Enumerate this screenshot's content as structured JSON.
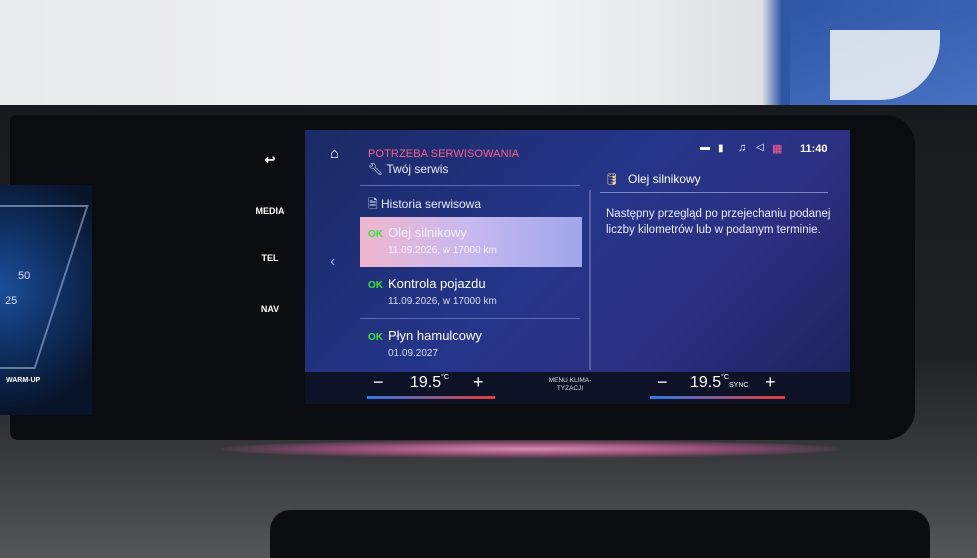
{
  "header": {
    "title": "POTRZEBA SERWISOWANIA",
    "submenu": "Twój serwis",
    "history": "Historia serwisowa"
  },
  "left_buttons": [
    {
      "label": "MEDIA"
    },
    {
      "label": "TEL"
    },
    {
      "label": "NAV"
    }
  ],
  "cluster": {
    "n50": "50",
    "n25": "25",
    "warmup": "WARM-UP"
  },
  "items": [
    {
      "status": "OK",
      "title": "Olej silnikowy",
      "sub": "11.09.2026, w 17000 km"
    },
    {
      "status": "OK",
      "title": "Kontrola pojazdu",
      "sub": "11.09.2026, w 17000 km"
    },
    {
      "status": "OK",
      "title": "Płyn hamulcowy",
      "sub": "01.09.2027"
    }
  ],
  "detail": {
    "title": "Olej silnikowy",
    "text": "Następny przegląd po przejechaniu podanej liczby kilometrów lub w podanym terminie."
  },
  "status_bar": {
    "time": "11:40"
  },
  "climate": {
    "left_temp": "19.5",
    "left_unit": "°C",
    "right_temp": "19.5",
    "right_unit": "°C",
    "right_sync": "SYNC",
    "menu_line1": "MENU KLIMA-",
    "menu_line2": "TYZACJI",
    "minus": "−",
    "plus": "+"
  },
  "colors": {
    "accent_pink": "#ff5e8a",
    "ok_green": "#37e637",
    "screen_bg": "#25358a"
  }
}
